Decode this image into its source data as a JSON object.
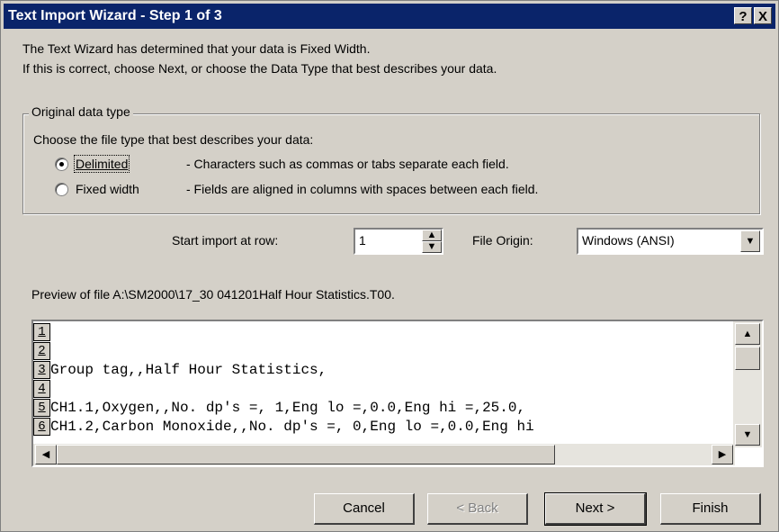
{
  "window": {
    "title": "Text Import Wizard - Step 1 of 3",
    "help_button": "?",
    "close_button": "X"
  },
  "intro": {
    "line1": "The Text Wizard has determined that your data is Fixed Width.",
    "line2": "If this is correct, choose Next, or choose the Data Type that best describes your data."
  },
  "original_data_type": {
    "legend": "Original data type",
    "prompt": "Choose the file type that best describes your data:",
    "options": [
      {
        "label": "Delimited",
        "description": "- Characters such as commas or tabs separate each field.",
        "selected": true
      },
      {
        "label": "Fixed width",
        "description": "- Fields are aligned in columns with spaces between each field.",
        "selected": false
      }
    ]
  },
  "start_row": {
    "label": "Start import at row:",
    "value": "1"
  },
  "file_origin": {
    "label": "File Origin:",
    "value": "Windows (ANSI)"
  },
  "preview": {
    "label": "Preview of file A:\\SM2000\\17_30 041201Half Hour Statistics.T00.",
    "rows": [
      {
        "num": "1",
        "text": ""
      },
      {
        "num": "2",
        "text": ""
      },
      {
        "num": "3",
        "text": "Group tag,,Half Hour Statistics,"
      },
      {
        "num": "4",
        "text": ""
      },
      {
        "num": "5",
        "text": "CH1.1,Oxygen,,No. dp's =, 1,Eng lo =,0.0,Eng hi =,25.0,"
      },
      {
        "num": "6",
        "text": "CH1.2,Carbon Monoxide,,No. dp's =, 0,Eng lo =,0.0,Eng hi"
      }
    ]
  },
  "buttons": {
    "cancel": "Cancel",
    "back": "< Back",
    "next": "Next >",
    "finish": "Finish"
  }
}
